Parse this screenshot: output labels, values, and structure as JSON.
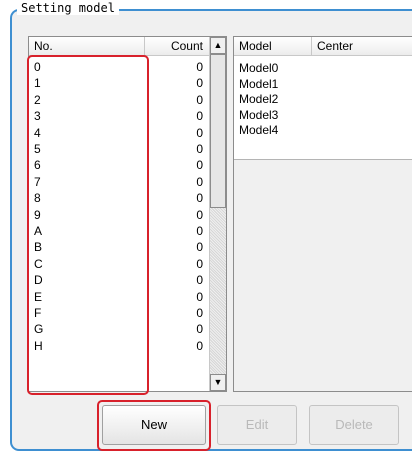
{
  "group_title": "Setting model",
  "list": {
    "header_no": "No.",
    "header_count": "Count",
    "rows": [
      {
        "no": "0",
        "count": "0"
      },
      {
        "no": "1",
        "count": "0"
      },
      {
        "no": "2",
        "count": "0"
      },
      {
        "no": "3",
        "count": "0"
      },
      {
        "no": "4",
        "count": "0"
      },
      {
        "no": "5",
        "count": "0"
      },
      {
        "no": "6",
        "count": "0"
      },
      {
        "no": "7",
        "count": "0"
      },
      {
        "no": "8",
        "count": "0"
      },
      {
        "no": "9",
        "count": "0"
      },
      {
        "no": "A",
        "count": "0"
      },
      {
        "no": "B",
        "count": "0"
      },
      {
        "no": "C",
        "count": "0"
      },
      {
        "no": "D",
        "count": "0"
      },
      {
        "no": "E",
        "count": "0"
      },
      {
        "no": "F",
        "count": "0"
      },
      {
        "no": "G",
        "count": "0"
      },
      {
        "no": "H",
        "count": "0"
      }
    ],
    "scroll_up_icon": "▲",
    "scroll_down_icon": "▼"
  },
  "models": {
    "header_model": "Model",
    "header_center": "Center",
    "rows": [
      "Model0",
      "Model1",
      "Model2",
      "Model3",
      "Model4"
    ]
  },
  "buttons": {
    "new": "New",
    "edit": "Edit",
    "delete": "Delete"
  },
  "colors": {
    "highlight": "#d8212b",
    "group_border": "#3e8fd1"
  }
}
